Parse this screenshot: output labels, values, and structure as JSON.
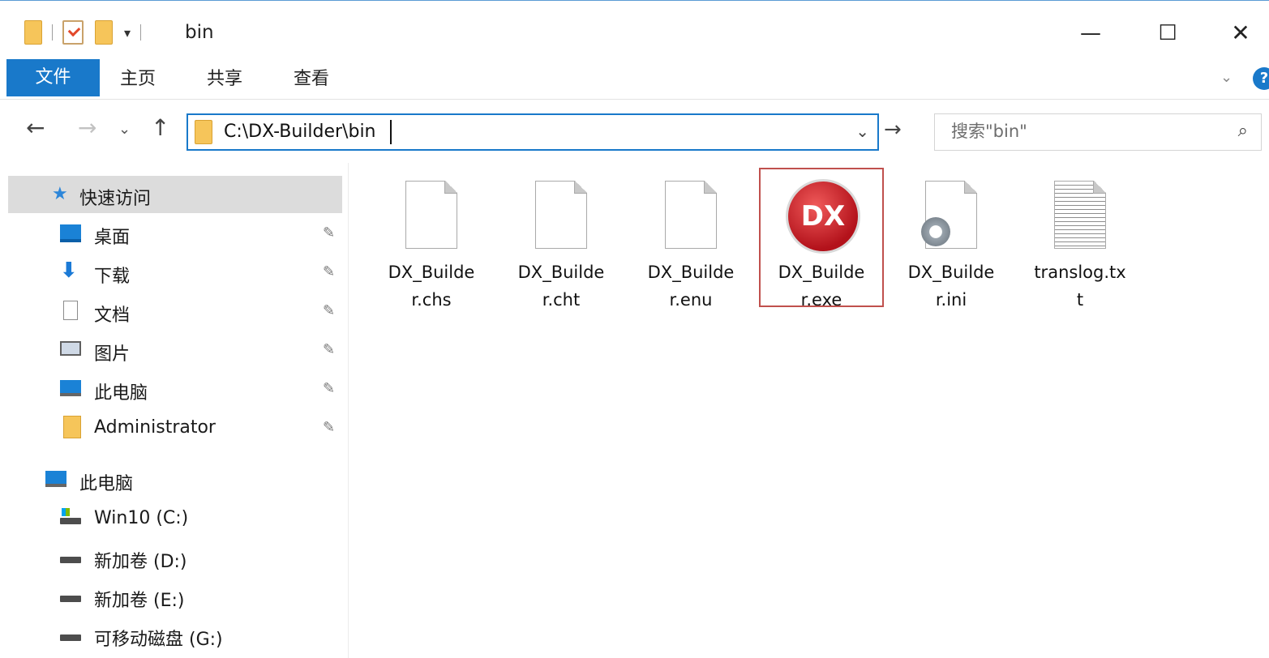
{
  "title_bar": {
    "title": "bin",
    "qat_dropdown": "▾",
    "minimize": "—",
    "maximize": "☐",
    "close": "✕"
  },
  "ribbon": {
    "tabs": [
      {
        "label": "文件",
        "active": true
      },
      {
        "label": "主页"
      },
      {
        "label": "共享"
      },
      {
        "label": "查看"
      }
    ],
    "expand": "⌄",
    "help": "?"
  },
  "nav": {
    "back": "←",
    "forward": "→",
    "recent": "⌄",
    "up": "↑",
    "address": "C:\\DX-Builder\\bin",
    "address_dropdown": "⌄",
    "go": "→",
    "search_placeholder": "搜索\"bin\"",
    "search_icon": "⌕"
  },
  "sidebar": {
    "quick_access": {
      "label": "快速访问",
      "icon": "star-icon"
    },
    "pinned": [
      {
        "label": "桌面",
        "icon": "desktop-icon",
        "pin": "📌"
      },
      {
        "label": "下载",
        "icon": "download-icon",
        "pin": "📌"
      },
      {
        "label": "文档",
        "icon": "document-icon",
        "pin": "📌"
      },
      {
        "label": "图片",
        "icon": "pictures-icon",
        "pin": "📌"
      },
      {
        "label": "此电脑",
        "icon": "computer-icon",
        "pin": "📌"
      },
      {
        "label": "Administrator",
        "icon": "folder-icon",
        "pin": "📌"
      }
    ],
    "this_pc": {
      "label": "此电脑",
      "icon": "computer-icon"
    },
    "drives": [
      {
        "label": "Win10 (C:)",
        "icon": "system-drive-icon"
      },
      {
        "label": "新加卷 (D:)",
        "icon": "drive-icon"
      },
      {
        "label": "新加卷 (E:)",
        "icon": "drive-icon"
      },
      {
        "label": "可移动磁盘 (G:)",
        "icon": "removable-drive-icon"
      }
    ]
  },
  "files": [
    {
      "line1": "DX_Builde",
      "line2": "r.chs",
      "icon": "document-icon"
    },
    {
      "line1": "DX_Builde",
      "line2": "r.cht",
      "icon": "document-icon"
    },
    {
      "line1": "DX_Builde",
      "line2": "r.enu",
      "icon": "document-icon"
    },
    {
      "line1": "DX_Builde",
      "line2": "r.exe",
      "icon": "dx-app-icon",
      "logo_text": "DX",
      "highlighted": true
    },
    {
      "line1": "DX_Builde",
      "line2": "r.ini",
      "icon": "config-file-icon"
    },
    {
      "line1": "translog.tx",
      "line2": "t",
      "icon": "text-file-icon"
    }
  ],
  "colors": {
    "accent": "#1979ca",
    "highlight_border": "#c0504d",
    "folder": "#f6c55a",
    "selection": "#dcdcdc"
  }
}
